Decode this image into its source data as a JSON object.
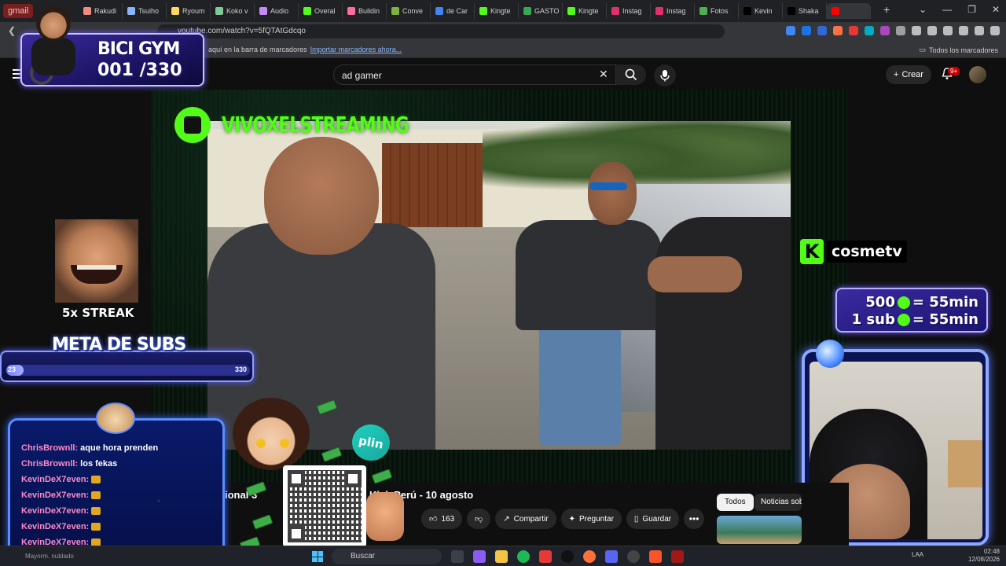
{
  "browser": {
    "gmail_tab": "gmail",
    "tabs": [
      {
        "label": "Rakudi",
        "color": "#f28b82"
      },
      {
        "label": "Tsuiho",
        "color": "#8ab4f8"
      },
      {
        "label": "Ryoum",
        "color": "#fdd663"
      },
      {
        "label": "Koko v",
        "color": "#81c995"
      },
      {
        "label": "Audio",
        "color": "#c58af9"
      },
      {
        "label": "Overal",
        "color": "#53fc18"
      },
      {
        "label": "Buildin",
        "color": "#ff6d9f"
      },
      {
        "label": "Conve",
        "color": "#7cb342"
      },
      {
        "label": "de Car",
        "color": "#4285f4"
      },
      {
        "label": "Kingte",
        "color": "#53fc18"
      },
      {
        "label": "GASTO",
        "color": "#34a853"
      },
      {
        "label": "Kingte",
        "color": "#53fc18"
      },
      {
        "label": "Instag",
        "color": "#e1306c"
      },
      {
        "label": "Instag",
        "color": "#e1306c"
      },
      {
        "label": "Fotos",
        "color": "#4caf50"
      },
      {
        "label": "Kevin",
        "color": "#000000"
      },
      {
        "label": "Shaka",
        "color": "#000000"
      },
      {
        "label": "",
        "color": "#ff0000"
      }
    ],
    "new_tab": "+",
    "url": "youtube.com/watch?v=5fQTAtGdcqo",
    "bookmarks_hint": "aquí en la barra de marcadores",
    "bookmarks_import": "Importar marcadores ahora...",
    "all_bookmarks": "Todos los marcadores"
  },
  "youtube": {
    "search_query": "ad gamer",
    "create_label": "Crear",
    "notifications": "9+",
    "video_title_left": "ional 3",
    "video_title_right": "Kick Perú - 10 agosto",
    "likes": "163",
    "share": "Compartir",
    "ask": "Preguntar",
    "save": "Guardar",
    "more": "•••",
    "chip_all": "Todos",
    "chip_news": "Noticias sob"
  },
  "overlay": {
    "channel": "VIVOXELSTREAMING",
    "kick_user": "cosmetv",
    "bici_title": "BICI GYM",
    "bici_count": "001 /330",
    "streak": "5x STREAK",
    "meta_title": "META DE SUBS",
    "meta_current": "23",
    "meta_goal": "330",
    "meta_progress": 0.07,
    "rate_1": "500",
    "rate_1_value": "= 55min",
    "rate_2": "1 sub",
    "rate_2_value": "= 55min",
    "plin": "plin"
  },
  "chat": [
    {
      "user": "ChrisBrownll:",
      "msg": " aque hora prenden"
    },
    {
      "user": "ChrisBrownll:",
      "msg": " los fekas"
    },
    {
      "user": "KevinDeX7even:",
      "msg": " "
    },
    {
      "user": "KevinDeX7even:",
      "msg": " "
    },
    {
      "user": "KevinDeX7even:",
      "msg": " "
    },
    {
      "user": "KevinDeX7even:",
      "msg": " "
    },
    {
      "user": "KevinDeX7even:",
      "msg": " "
    }
  ],
  "taskbar": {
    "weather": "Mayorm. nublado",
    "search": "Buscar",
    "lang": "LAA",
    "time": "02:48",
    "date": "12/08/2026"
  }
}
